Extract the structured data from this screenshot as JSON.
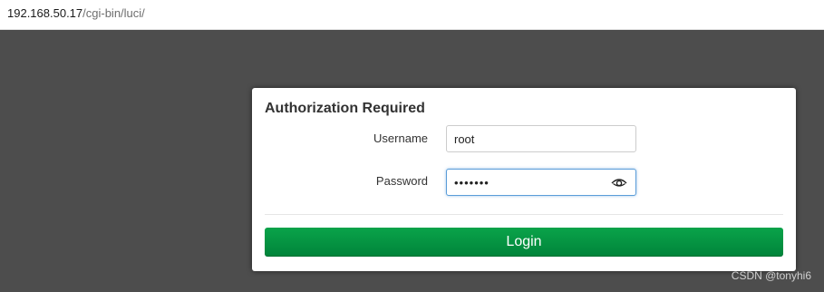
{
  "browser": {
    "url_host": "192.168.50.17",
    "url_path": "/cgi-bin/luci/"
  },
  "dialog": {
    "title": "Authorization Required",
    "username_label": "Username",
    "username_value": "root",
    "password_label": "Password",
    "password_value": "•••••••",
    "password_toggle_icon": "eye-icon",
    "login_label": "Login"
  },
  "watermark": "CSDN @tonyhi6",
  "colors": {
    "backdrop": "#4d4d4d",
    "login_button": "#00963f",
    "focus_border": "#5b9dd9"
  }
}
